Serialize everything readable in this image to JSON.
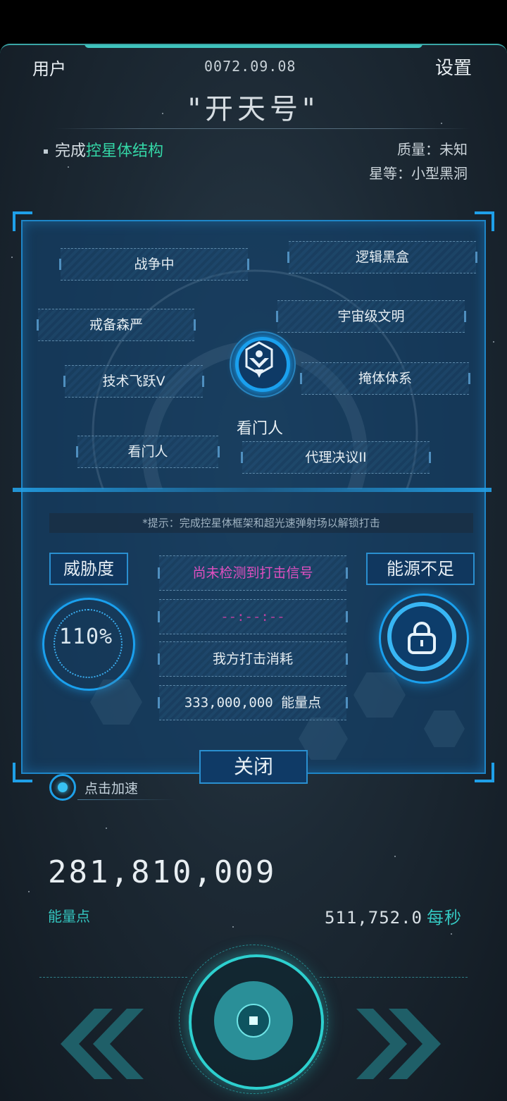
{
  "header": {
    "user_label": "用户",
    "date": "0072.09.08",
    "settings_label": "设置",
    "ship_name": "\"开天号\""
  },
  "status": {
    "task_prefix": "完成",
    "task_highlight": "控星体结构",
    "mass": "质量：未知",
    "star_class": "星等：小型黑洞"
  },
  "panel": {
    "tags": [
      "战争中",
      "逻辑黑盒",
      "戒备森严",
      "宇宙级文明",
      "技术飞跃V",
      "掩体体系",
      "看门人",
      "代理决议II"
    ],
    "emblem_label": "看门人",
    "hint": "*提示：完成控星体框架和超光速弹射场以解锁打击",
    "threat_label": "威胁度",
    "threat_value": "110%",
    "energy_warning": "能源不足",
    "strike_signal": "尚未检测到打击信号",
    "strike_timer": "--:--:--",
    "strike_cost_label": "我方打击消耗",
    "strike_cost_value": "333,000,000 能量点",
    "close_label": "关闭"
  },
  "speed_up_label": "点击加速",
  "resources": {
    "energy_value": "281,810,009",
    "energy_unit": "能量点",
    "rate_value": "511,752.0",
    "rate_unit": "每秒"
  },
  "icons": {
    "lock": "lock-icon",
    "emblem": "phoenix-emblem-icon",
    "left": "double-chevron-left-icon",
    "right": "double-chevron-right-icon"
  },
  "colors": {
    "accent_blue": "#1e86c8",
    "accent_teal": "#34c6c0",
    "highlight_green": "#34d6a6",
    "signal_pink": "#e04fc0"
  }
}
